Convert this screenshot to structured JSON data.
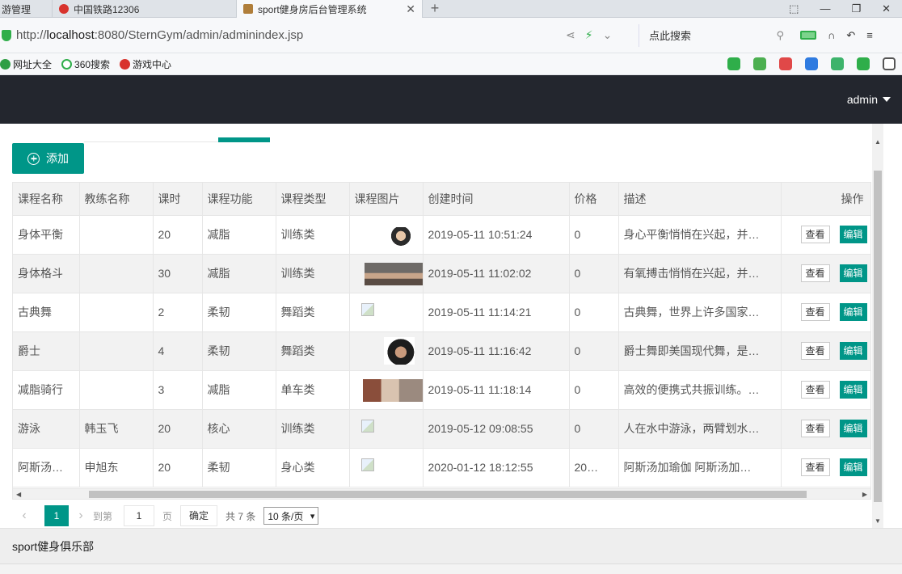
{
  "browser": {
    "tabs": [
      {
        "label": "游管理",
        "fav_color": "#9aa"
      },
      {
        "label": "中国铁路12306",
        "fav_color": "#d8332d"
      },
      {
        "label": "sport健身房后台管理系统",
        "fav_color": "#b07e3a",
        "close": "✕"
      }
    ],
    "new_tab": "+",
    "url_prefix": "http://",
    "url_host": "localhost",
    "url_rest": ":8080/SternGym/admin/adminindex.jsp",
    "search_placeholder": "点此搜索",
    "bookmarks": [
      {
        "label": "网址大全",
        "color": "#2f9e44"
      },
      {
        "label": "360搜索",
        "color": "#2fae4a"
      },
      {
        "label": "游戏中心",
        "color": "#d8332d"
      }
    ]
  },
  "header": {
    "user": "admin"
  },
  "toolbar": {
    "add_label": "添加"
  },
  "table": {
    "columns": [
      "课程名称",
      "教练名称",
      "课时",
      "课程功能",
      "课程类型",
      "课程图片",
      "创建时间",
      "价格",
      "描述",
      "操作"
    ],
    "rows": [
      {
        "name": "身体平衡",
        "coach": "",
        "hours": "20",
        "function": "减脂",
        "type": "训练类",
        "image": "face1",
        "created": "2019-05-11 10:51:24",
        "price": "0",
        "desc": "身心平衡悄悄在兴起，并…"
      },
      {
        "name": "身体格斗",
        "coach": "",
        "hours": "30",
        "function": "减脂",
        "type": "训练类",
        "image": "face2",
        "created": "2019-05-11 11:02:02",
        "price": "0",
        "desc": "有氧搏击悄悄在兴起，并…"
      },
      {
        "name": "古典舞",
        "coach": "",
        "hours": "2",
        "function": "柔韧",
        "type": "舞蹈类",
        "image": "broken",
        "created": "2019-05-11 11:14:21",
        "price": "0",
        "desc": "古典舞，世界上许多国家…"
      },
      {
        "name": "爵士",
        "coach": "",
        "hours": "4",
        "function": "柔韧",
        "type": "舞蹈类",
        "image": "face3",
        "created": "2019-05-11 11:16:42",
        "price": "0",
        "desc": "爵士舞即美国现代舞，是…"
      },
      {
        "name": "减脂骑行",
        "coach": "",
        "hours": "3",
        "function": "减脂",
        "type": "单车类",
        "image": "face4",
        "created": "2019-05-11 11:18:14",
        "price": "0",
        "desc": "高效的便携式共振训练。…"
      },
      {
        "name": "游泳",
        "coach": "韩玉飞",
        "hours": "20",
        "function": "核心",
        "type": "训练类",
        "image": "broken",
        "created": "2019-05-12 09:08:55",
        "price": "0",
        "desc": "人在水中游泳，两臂划水…"
      },
      {
        "name": "阿斯汤…",
        "coach": "申旭东",
        "hours": "20",
        "function": "柔韧",
        "type": "身心类",
        "image": "broken",
        "created": "2020-01-12 18:12:55",
        "price": "20…",
        "desc": "阿斯汤加瑜伽 阿斯汤加…"
      }
    ],
    "view_label": "查看",
    "edit_label": "编辑"
  },
  "pager": {
    "prev": "‹",
    "current": "1",
    "next": "›",
    "goto_label": "到第",
    "goto_value": "1",
    "page_label": "页",
    "confirm_label": "确定",
    "total": "共 7 条",
    "page_size": "10 条/页"
  },
  "footer": {
    "text": "sport健身俱乐部"
  },
  "colors": {
    "accent": "#009688",
    "header_bg": "#23262e"
  }
}
